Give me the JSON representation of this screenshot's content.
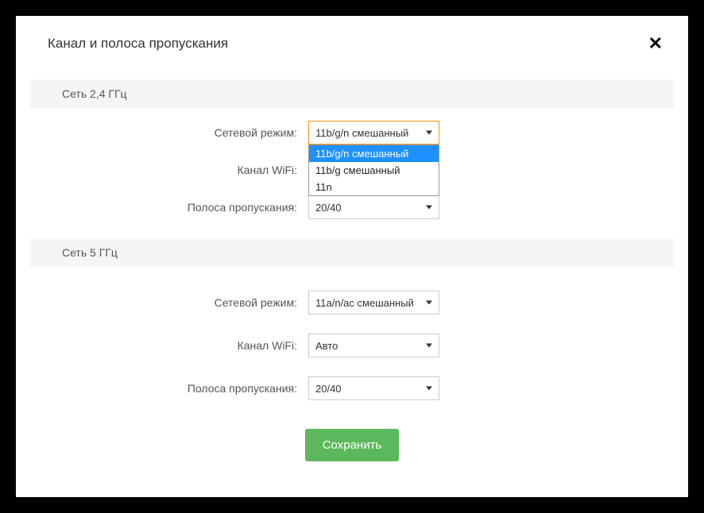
{
  "modal": {
    "title": "Канал и полоса пропускания",
    "save_label": "Сохранить"
  },
  "section24": {
    "title": "Сеть 2,4 ГГц",
    "mode_label": "Сетевой режим:",
    "mode_value": "11b/g/n смешанный",
    "mode_options": [
      "11b/g/n смешанный",
      "11b/g смешанный",
      "11n"
    ],
    "channel_label": "Канал WiFi:",
    "bandwidth_label": "Полоса пропускания:",
    "bandwidth_value": "20/40"
  },
  "section5": {
    "title": "Сеть 5 ГГц",
    "mode_label": "Сетевой режим:",
    "mode_value": "11a/n/ac смешанный",
    "channel_label": "Канал WiFi:",
    "channel_value": "Авто",
    "bandwidth_label": "Полоса пропускания:",
    "bandwidth_value": "20/40"
  }
}
